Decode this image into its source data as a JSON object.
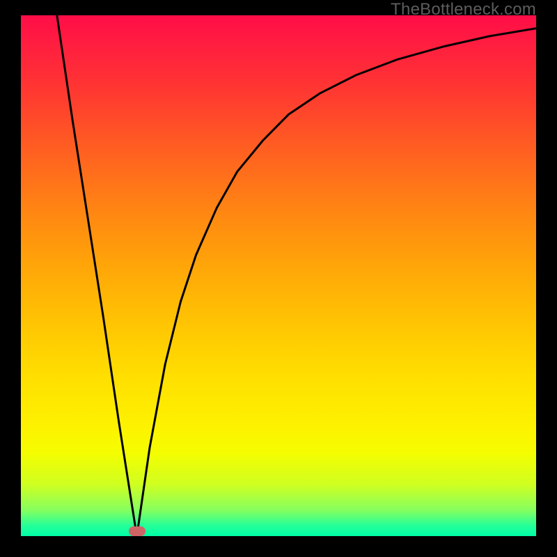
{
  "watermark": {
    "text": "TheBottleneck.com"
  },
  "marker": {
    "left_pct": 22.5,
    "top_pct": 99.0
  },
  "chart_data": {
    "type": "line",
    "title": "",
    "xlabel": "",
    "ylabel": "",
    "xlim": [
      0,
      100
    ],
    "ylim": [
      0,
      100
    ],
    "grid": false,
    "legend": null,
    "background": "rainbow-gradient (red top → green bottom)",
    "marker_point": {
      "x": 22.5,
      "y": 0
    },
    "series": [
      {
        "name": "curve",
        "x": [
          7,
          10,
          13,
          16,
          19,
          22.5,
          25,
          28,
          31,
          34,
          38,
          42,
          47,
          52,
          58,
          65,
          73,
          82,
          91,
          100
        ],
        "y": [
          100,
          80,
          61,
          42,
          22,
          0,
          17,
          33,
          45,
          54,
          63,
          70,
          76,
          81,
          85,
          88.5,
          91.5,
          94,
          96,
          97.5
        ]
      }
    ]
  }
}
